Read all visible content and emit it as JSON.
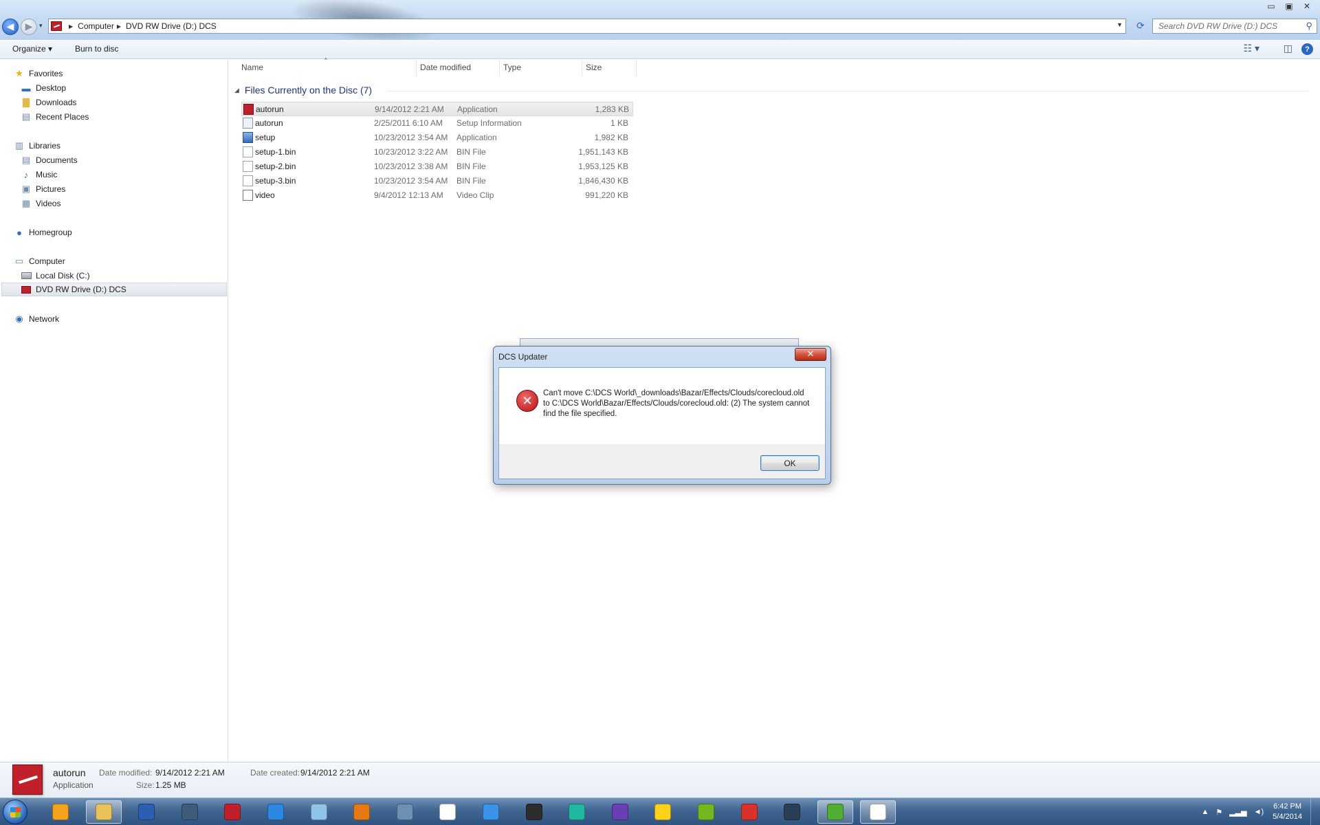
{
  "window": {
    "minimize": "▭",
    "maximize": "▣",
    "close": "✕"
  },
  "address": {
    "crumbs": [
      "Computer",
      "DVD RW Drive (D:) DCS"
    ],
    "search_placeholder": "Search DVD RW Drive (D:) DCS"
  },
  "toolbar": {
    "organize": "Organize ▾",
    "burn": "Burn to disc"
  },
  "nav": {
    "favorites": "Favorites",
    "desktop": "Desktop",
    "downloads": "Downloads",
    "recent": "Recent Places",
    "libraries": "Libraries",
    "documents": "Documents",
    "music": "Music",
    "pictures": "Pictures",
    "videos": "Videos",
    "homegroup": "Homegroup",
    "computer": "Computer",
    "local_disk": "Local Disk (C:)",
    "dvd": "DVD RW Drive (D:) DCS",
    "network": "Network"
  },
  "columns": {
    "name": "Name",
    "date": "Date modified",
    "type": "Type",
    "size": "Size"
  },
  "group_title": "Files Currently on the Disc (7)",
  "files": [
    {
      "name": "autorun",
      "date": "9/14/2012 2:21 AM",
      "type": "Application",
      "size": "1,283 KB"
    },
    {
      "name": "autorun",
      "date": "2/25/2011 6:10 AM",
      "type": "Setup Information",
      "size": "1 KB"
    },
    {
      "name": "setup",
      "date": "10/23/2012 3:54 AM",
      "type": "Application",
      "size": "1,982 KB"
    },
    {
      "name": "setup-1.bin",
      "date": "10/23/2012 3:22 AM",
      "type": "BIN File",
      "size": "1,951,143 KB"
    },
    {
      "name": "setup-2.bin",
      "date": "10/23/2012 3:38 AM",
      "type": "BIN File",
      "size": "1,953,125 KB"
    },
    {
      "name": "setup-3.bin",
      "date": "10/23/2012 3:54 AM",
      "type": "BIN File",
      "size": "1,846,430 KB"
    },
    {
      "name": "video",
      "date": "9/4/2012 12:13 AM",
      "type": "Video Clip",
      "size": "991,220 KB"
    }
  ],
  "dialog": {
    "title": "DCS Updater",
    "close": "✕",
    "message": "Can't move C:\\DCS World\\_downloads\\Bazar/Effects/Clouds/corecloud.old to C:\\DCS World\\Bazar/Effects/Clouds/corecloud.old: (2) The system cannot find the file specified.",
    "ok": "OK"
  },
  "details": {
    "name": "autorun",
    "type": "Application",
    "modified_label": "Date modified:",
    "modified_value": "9/14/2012 2:21 AM",
    "size_label": "Size:",
    "size_value": "1.25 MB",
    "created_label": "Date created:",
    "created_value": "9/14/2012 2:21 AM"
  },
  "clock": {
    "time": "6:42 PM",
    "date": "5/4/2014"
  },
  "taskbar_apps": [
    {
      "name": "outlook-icon",
      "color": "#f2a21b"
    },
    {
      "name": "explorer-icon",
      "color": "#e9c25a",
      "active": true
    },
    {
      "name": "word-icon",
      "color": "#2b5fb4"
    },
    {
      "name": "media-center-icon",
      "color": "#3d5c7a"
    },
    {
      "name": "dcs-icon",
      "color": "#c0202a"
    },
    {
      "name": "internet-explorer-icon",
      "color": "#2c88e0"
    },
    {
      "name": "notepad-icon",
      "color": "#8fc3e8"
    },
    {
      "name": "blender-icon",
      "color": "#e67a12"
    },
    {
      "name": "window-app-icon",
      "color": "#6d8fb3"
    },
    {
      "name": "document-icon",
      "color": "#ffffff"
    },
    {
      "name": "itunes-icon",
      "color": "#3a93e6"
    },
    {
      "name": "display-app-icon",
      "color": "#2d2d2d"
    },
    {
      "name": "robot-app-icon",
      "color": "#21b8a0"
    },
    {
      "name": "globe-app-icon",
      "color": "#6a3fb5"
    },
    {
      "name": "orb-app-icon",
      "color": "#ffd21a"
    },
    {
      "name": "w-app-icon",
      "color": "#73b81f"
    },
    {
      "name": "ccleaner-icon",
      "color": "#d9322a"
    },
    {
      "name": "steam-icon",
      "color": "#2a3f56"
    },
    {
      "name": "utorrent-icon",
      "color": "#4fae2f",
      "active": true
    },
    {
      "name": "document-app-icon",
      "color": "#ffffff",
      "active": true
    }
  ]
}
